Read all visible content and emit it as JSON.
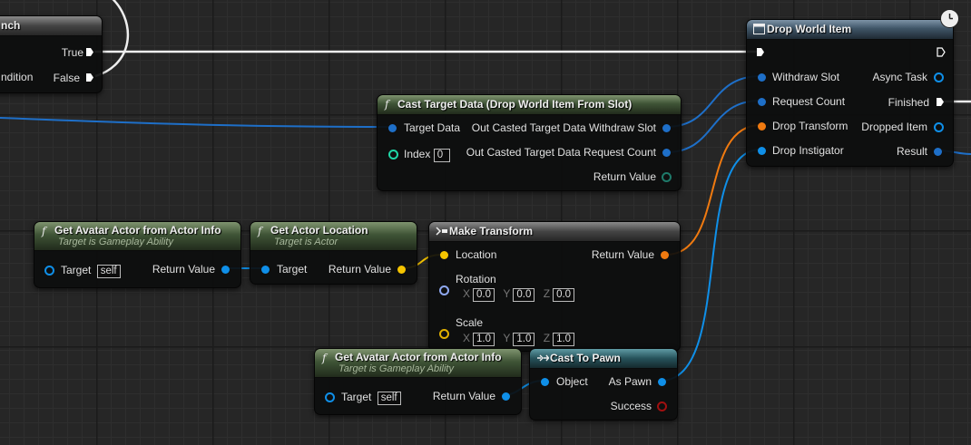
{
  "nodes": {
    "branch": {
      "title": "nch",
      "pins": {
        "condition": "ndition",
        "true": "True",
        "false": "False"
      }
    },
    "drop_world_item": {
      "title": "Drop World Item",
      "inputs": [
        "Withdraw Slot",
        "Request Count",
        "Drop Transform",
        "Drop Instigator"
      ],
      "outputs": [
        "Async Task",
        "Finished",
        "Dropped Item",
        "Result"
      ]
    },
    "cast_target_data": {
      "title": "Cast Target Data (Drop World Item From Slot)",
      "target_data": "Target Data",
      "index_label": "Index",
      "index_value": "0",
      "out_withdraw": "Out Casted Target Data Withdraw Slot",
      "out_request": "Out Casted Target Data Request Count",
      "return_value": "Return Value"
    },
    "get_avatar_1": {
      "title": "Get Avatar Actor from Actor Info",
      "subtitle": "Target is Gameplay Ability",
      "target": "Target",
      "self": "self",
      "return_value": "Return Value"
    },
    "get_actor_location": {
      "title": "Get Actor Location",
      "subtitle": "Target is Actor",
      "target": "Target",
      "return_value": "Return Value"
    },
    "make_transform": {
      "title": "Make Transform",
      "location": "Location",
      "rotation": "Rotation",
      "rotation_values": {
        "x": "0.0",
        "y": "0.0",
        "z": "0.0"
      },
      "scale": "Scale",
      "scale_values": {
        "x": "1.0",
        "y": "1.0",
        "z": "1.0"
      },
      "axis": {
        "x": "X",
        "y": "Y",
        "z": "Z"
      },
      "return_value": "Return Value"
    },
    "get_avatar_2": {
      "title": "Get Avatar Actor from Actor Info",
      "subtitle": "Target is Gameplay Ability",
      "target": "Target",
      "self": "self",
      "return_value": "Return Value"
    },
    "cast_to_pawn": {
      "title": "Cast To Pawn",
      "object": "Object",
      "as_pawn": "As Pawn",
      "success": "Success"
    }
  },
  "colors": {
    "exec": "#ffffff",
    "object": "#0f8fe8",
    "struct_transform": "#f07a10",
    "vector": "#f5c400",
    "rotator": "#8fa8f0",
    "struct_data": "#1e6fc8",
    "int": "#1fd6a6",
    "bool": "#a01010"
  },
  "icons": [
    "function-icon",
    "make-struct-icon",
    "cast-icon",
    "latent-clock-icon",
    "task-node-icon"
  ]
}
